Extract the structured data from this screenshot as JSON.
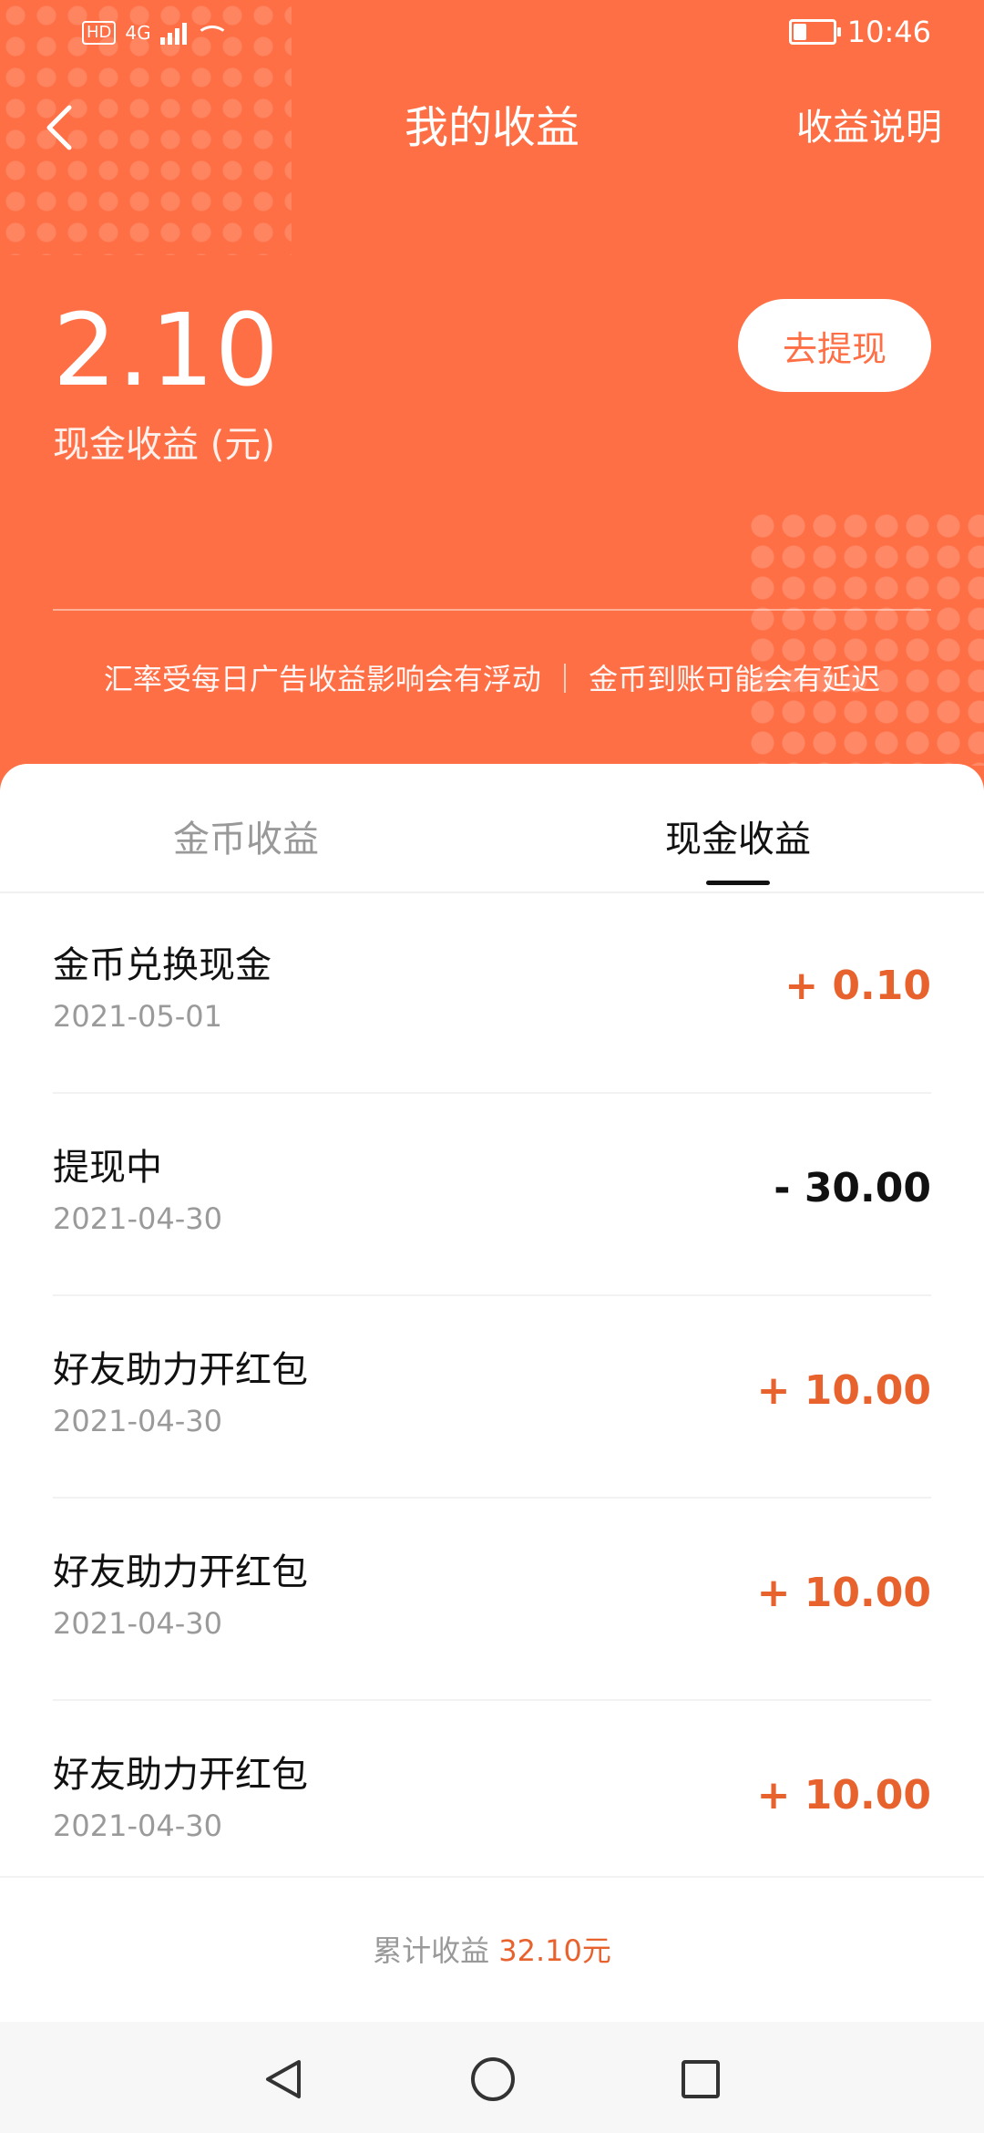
{
  "status_bar": {
    "hd": "HD",
    "network": "4G",
    "time": "10:46"
  },
  "header": {
    "title": "我的收益",
    "explain_label": "收益说明",
    "back_icon": "chevron-left-icon"
  },
  "balance": {
    "amount": "2.10",
    "label": "现金收益 (元)",
    "withdraw_label": "去提现"
  },
  "notice": "汇率受每日广告收益影响会有浮动 ｜ 金币到账可能会有延迟",
  "tabs": [
    {
      "label": "金币收益",
      "active": false
    },
    {
      "label": "现金收益",
      "active": true
    }
  ],
  "list": [
    {
      "title": "金币兑换现金",
      "date": "2021-05-01",
      "amount": "+ 0.10",
      "type": "positive"
    },
    {
      "title": "提现中",
      "date": "2021-04-30",
      "amount": "- 30.00",
      "type": "negative"
    },
    {
      "title": "好友助力开红包",
      "date": "2021-04-30",
      "amount": "+ 10.00",
      "type": "positive"
    },
    {
      "title": "好友助力开红包",
      "date": "2021-04-30",
      "amount": "+ 10.00",
      "type": "positive"
    },
    {
      "title": "好友助力开红包",
      "date": "2021-04-30",
      "amount": "+ 10.00",
      "type": "positive"
    }
  ],
  "footer": {
    "label": "累计收益",
    "value": "32.10元"
  },
  "colors": {
    "header_bg": "#FF6F45",
    "accent": "#E8622D"
  }
}
